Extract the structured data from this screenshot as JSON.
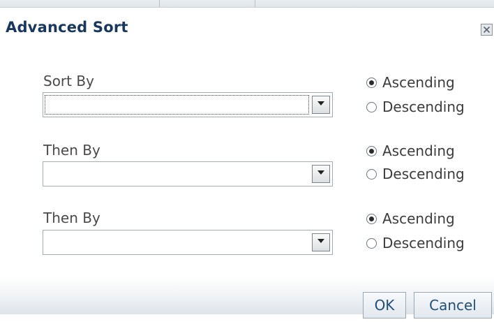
{
  "dialog": {
    "title": "Advanced Sort",
    "close_icon": "close-icon"
  },
  "rows": [
    {
      "label": "Sort By",
      "selected_value": "",
      "asc_label": "Ascending",
      "desc_label": "Descending",
      "order": "ascending"
    },
    {
      "label": "Then By",
      "selected_value": "",
      "asc_label": "Ascending",
      "desc_label": "Descending",
      "order": "ascending"
    },
    {
      "label": "Then By",
      "selected_value": "",
      "asc_label": "Ascending",
      "desc_label": "Descending",
      "order": "ascending"
    }
  ],
  "buttons": {
    "ok_label": "OK",
    "cancel_label": "Cancel"
  },
  "colors": {
    "title": "#17375e",
    "button_text": "#1f4e79"
  }
}
